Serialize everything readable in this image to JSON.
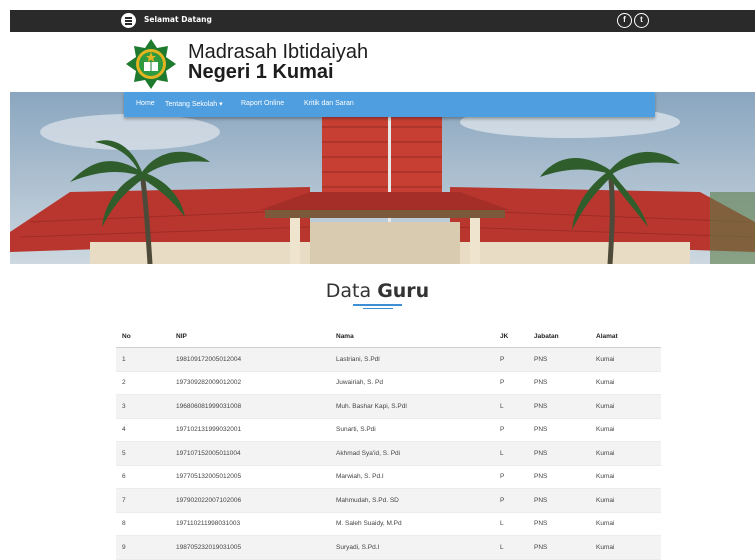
{
  "topbar": {
    "greeting": "Selamat Datang",
    "icons": [
      "menu-icon",
      "facebook-icon",
      "twitter-icon"
    ],
    "facebook_glyph": "f",
    "twitter_glyph": "t"
  },
  "header": {
    "name_line1": "Madrasah Ibtidaiyah",
    "name_line2": "Negeri 1 Kumai"
  },
  "nav": {
    "items": [
      "Home",
      "Tentang Sekolah",
      "Raport Online",
      "Kritik dan Saran"
    ],
    "dropdown_marker": "▾"
  },
  "section": {
    "title_light": "Data ",
    "title_bold": "Guru"
  },
  "table": {
    "headers": [
      "No",
      "NIP",
      "Nama",
      "JK",
      "Jabatan",
      "Alamat"
    ],
    "rows": [
      [
        "1",
        "198109172005012004",
        "Lastriani, S.Pdl",
        "P",
        "PNS",
        "Kumai"
      ],
      [
        "2",
        "197309282009012002",
        "Juwairiah, S. Pd",
        "P",
        "PNS",
        "Kumai"
      ],
      [
        "3",
        "196806081999031008",
        "Muh. Bashar Kapi, S.Pdl",
        "L",
        "PNS",
        "Kumai"
      ],
      [
        "4",
        "197102131999032001",
        "Sunarti, S.Pdi",
        "P",
        "PNS",
        "Kumai"
      ],
      [
        "5",
        "197107152005011004",
        "Akhmad Sya'id, S. Pdi",
        "L",
        "PNS",
        "Kumai"
      ],
      [
        "6",
        "197705132005012005",
        "Marwiah, S. Pd.I",
        "P",
        "PNS",
        "Kumai"
      ],
      [
        "7",
        "197902022007102006",
        "Mahmudah, S.Pd. SD",
        "P",
        "PNS",
        "Kumai"
      ],
      [
        "8",
        "197110211998031003",
        "M. Saleh Suaidy, M.Pd",
        "L",
        "PNS",
        "Kumai"
      ],
      [
        "9",
        "198705232019031005",
        "Suryadi, S.Pd.I",
        "L",
        "PNS",
        "Kumai"
      ]
    ]
  },
  "colors": {
    "topbar": "#2a2a2a",
    "nav": "#4f9ee0",
    "accent": "#3f8fd6",
    "logo_green": "#1e7a2e",
    "logo_gold": "#e2b422",
    "roof_red": "#b8362e"
  }
}
